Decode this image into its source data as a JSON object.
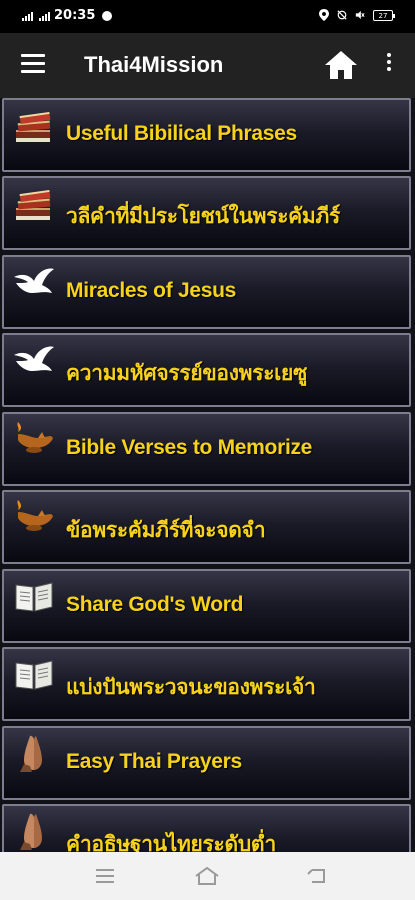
{
  "status_bar": {
    "time": "20:35",
    "battery": "27"
  },
  "app_bar": {
    "title": "Thai4Mission"
  },
  "menu_items": [
    {
      "label": "Useful Bibilical Phrases",
      "icon": "books-icon"
    },
    {
      "label": "วลีคำที่มีประโยชน์ในพระคัมภีร์",
      "icon": "books-icon"
    },
    {
      "label": "Miracles of Jesus",
      "icon": "dove-icon"
    },
    {
      "label": "ความมหัศจรรย์ของพระเยซู",
      "icon": "dove-icon"
    },
    {
      "label": "Bible Verses to Memorize",
      "icon": "oil-lamp-icon"
    },
    {
      "label": "ข้อพระคัมภีร์ที่จะจดจำ",
      "icon": "oil-lamp-icon"
    },
    {
      "label": "Share God's Word",
      "icon": "open-bible-icon"
    },
    {
      "label": "แบ่งปันพระวจนะของพระเจ้า",
      "icon": "open-bible-icon"
    },
    {
      "label": "Easy Thai Prayers",
      "icon": "praying-hands-icon"
    },
    {
      "label": "คำอธิษฐานไทยระดับต่ำ",
      "icon": "praying-hands-icon"
    }
  ],
  "colors": {
    "label_text": "#f6d21c",
    "app_bar": "#222222",
    "item_border": "#7d7d8f"
  }
}
